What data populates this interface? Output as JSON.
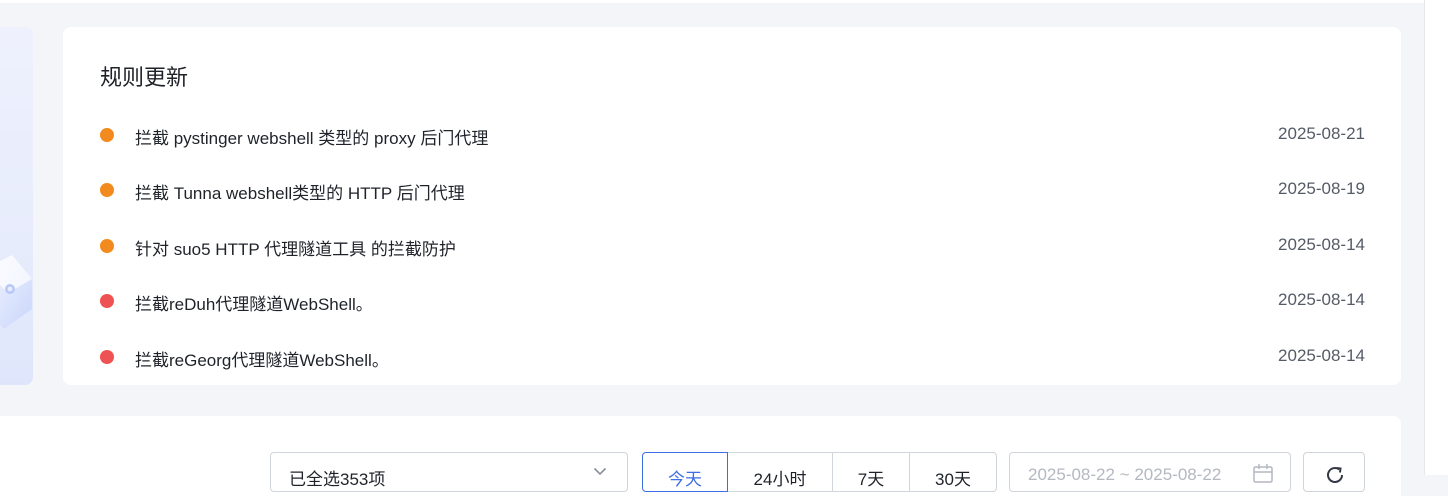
{
  "rules": {
    "title": "规则更新",
    "items": [
      {
        "text": "拦截 pystinger webshell 类型的 proxy 后门代理",
        "date": "2025-08-21",
        "dot_color": "#f28a1e"
      },
      {
        "text": "拦截 Tunna webshell类型的 HTTP 后门代理",
        "date": "2025-08-19",
        "dot_color": "#f28a1e"
      },
      {
        "text": "针对 suo5 HTTP 代理隧道工具 的拦截防护",
        "date": "2025-08-14",
        "dot_color": "#f28a1e"
      },
      {
        "text": "拦截reDuh代理隧道WebShell。",
        "date": "2025-08-14",
        "dot_color": "#ee5252"
      },
      {
        "text": "拦截reGeorg代理隧道WebShell。",
        "date": "2025-08-14",
        "dot_color": "#ee5252"
      }
    ]
  },
  "filters": {
    "select_value": "已全选353项",
    "time_ranges": [
      "今天",
      "24小时",
      "7天",
      "30天"
    ],
    "active_range": "今天",
    "date_range": "2025-08-22 ~ 2025-08-22"
  },
  "colors": {
    "accent": "#3d6ee6",
    "warning": "#f28a1e",
    "danger": "#ee5252"
  },
  "icons": {
    "select_arrow": "chevron-down-icon",
    "date": "calendar-icon",
    "refresh": "refresh-icon"
  }
}
